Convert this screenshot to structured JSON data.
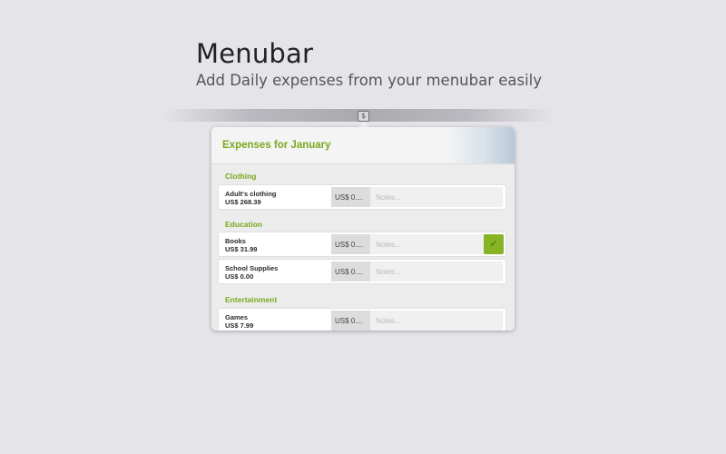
{
  "hero": {
    "title": "Menubar",
    "subtitle": "Add Daily expenses from your menubar easily"
  },
  "menubar": {
    "status_icon": "dollar-icon",
    "status_glyph": "$"
  },
  "popover": {
    "title": "Expenses for January",
    "sections": [
      {
        "heading": "Clothing",
        "items": [
          {
            "name": "Adult's clothing",
            "total": "US$ 268.39",
            "amount_value": "US$ 0....",
            "notes_placeholder": "Notes..."
          }
        ]
      },
      {
        "heading": "Education",
        "items": [
          {
            "name": "Books",
            "total": "US$ 31.99",
            "amount_value": "US$ 0....",
            "notes_placeholder": "Notes...",
            "save_glyph": "✔"
          },
          {
            "name": "School Supplies",
            "total": "US$ 0.00",
            "amount_value": "US$ 0....",
            "notes_placeholder": "Notes..."
          }
        ]
      },
      {
        "heading": "Entertainment",
        "items": [
          {
            "name": "Games",
            "total": "US$ 7.99",
            "amount_value": "US$ 0....",
            "notes_placeholder": "Notes..."
          }
        ]
      }
    ]
  },
  "colors": {
    "accent_green": "#7aa81f",
    "save_button": "#86b424",
    "background": "#e5e4e9"
  }
}
